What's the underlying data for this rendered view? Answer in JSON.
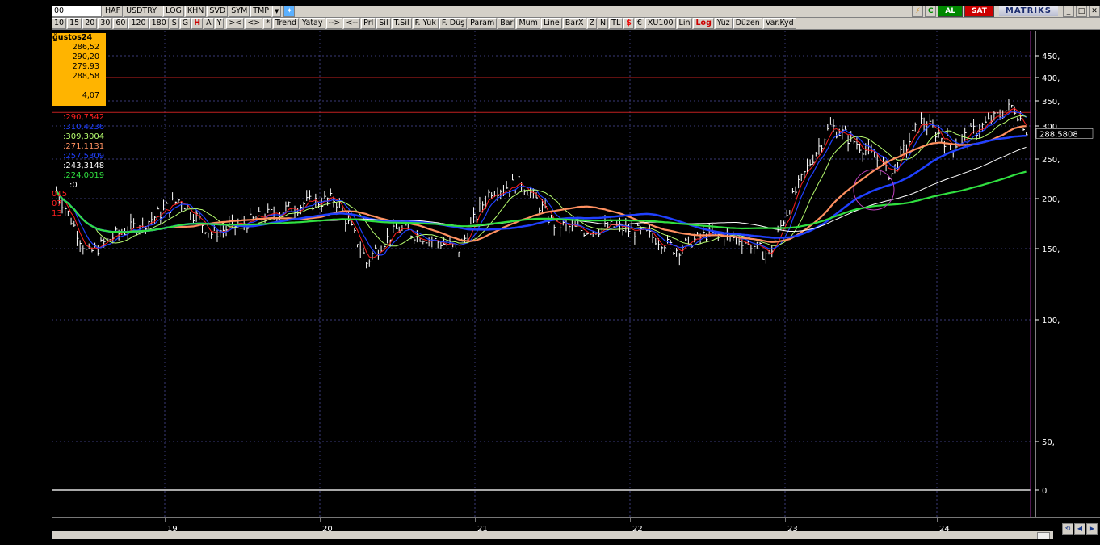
{
  "toolbar1": {
    "symbol_box": "00",
    "buttons": [
      "HAF",
      "USDTRY",
      "LOG",
      "KHN",
      "SVD",
      "SYM",
      "TMP"
    ],
    "dropdown": "▼",
    "al_label": "AL",
    "sat_label": "SAT",
    "logo_text": "MATRIKS",
    "window_buttons": [
      "_",
      "□",
      "✕"
    ],
    "colors": {
      "al": "#008800",
      "sat": "#cc0000"
    }
  },
  "toolbar2": {
    "periods": [
      "10",
      "15",
      "20",
      "30",
      "60",
      "120",
      "180",
      "S",
      "G",
      "H",
      "A",
      "Y"
    ],
    "active_period": "H",
    "tools": [
      ">< ",
      "<>",
      "*",
      "Trend",
      "Yatay",
      "-->",
      "<--",
      "Prl",
      "Sil",
      "T.Sil",
      "F. Yük",
      "F. Düş",
      "Param",
      "Bar",
      "Mum",
      "Line",
      "BarX",
      "Z",
      "N",
      "TL",
      "$",
      "€",
      "XU100",
      "Lin",
      "Log",
      "Yüz",
      "Düzen",
      "Var.Kyd"
    ]
  },
  "infobox": {
    "title": "ğustos24",
    "values": [
      "286,52",
      "290,20",
      "279,93",
      "288,58",
      "",
      "4,07"
    ]
  },
  "indicators": [
    {
      "label": ":290,7542",
      "color": "#ff2020"
    },
    {
      "label": ":310,4236",
      "color": "#2040ff"
    },
    {
      "label": ":309,3004",
      "color": "#b8ff70"
    },
    {
      "label": ":271,1131",
      "color": "#ff9060"
    },
    {
      "label": ":257,5309",
      "color": "#2040ff"
    },
    {
      "label": ":243,3148",
      "color": "#ffffff"
    },
    {
      "label": ":224,0019",
      "color": "#30e040"
    },
    {
      "label": ":0",
      "color": "#ffffff"
    }
  ],
  "side_labels": [
    {
      "label": "015",
      "color": "#ff2020"
    },
    {
      "label": "07",
      "color": "#ff2020"
    },
    {
      "label": "13",
      "color": "#ff2020"
    }
  ],
  "y_axis": {
    "ticks": [
      {
        "value": 450,
        "label": "450,"
      },
      {
        "value": 400,
        "label": "400,"
      },
      {
        "value": 350,
        "label": "350,"
      },
      {
        "value": 300,
        "label": "300,"
      },
      {
        "value": 250,
        "label": "250,"
      },
      {
        "value": 200,
        "label": "200,"
      },
      {
        "value": 150,
        "label": "150,"
      },
      {
        "value": 100,
        "label": "100,"
      },
      {
        "value": 50,
        "label": "50,"
      },
      {
        "value": 0,
        "label": "0"
      }
    ],
    "last_price": "288,5808"
  },
  "x_axis": {
    "labels": [
      "19",
      "20",
      "21",
      "22",
      "23",
      "24"
    ]
  },
  "horizontal_levels": [
    400,
    327
  ],
  "chart_data": {
    "type": "line",
    "x": [
      "2018.3",
      "2018.5",
      "2018.7",
      "2018.9",
      "2019.1",
      "2019.3",
      "2019.5",
      "2019.7",
      "2019.9",
      "2020.1",
      "2020.3",
      "2020.5",
      "2020.7",
      "2020.9",
      "2021.1",
      "2021.3",
      "2021.5",
      "2021.7",
      "2021.9",
      "2022.1",
      "2022.3",
      "2022.5",
      "2022.7",
      "2022.9",
      "2023.1",
      "2023.3",
      "2023.5",
      "2023.7",
      "2023.9",
      "2024.1",
      "2024.3",
      "2024.5",
      "2024.6"
    ],
    "series": [
      {
        "values": [
          210,
          145,
          165,
          178,
          200,
          165,
          175,
          185,
          195,
          200,
          140,
          170,
          160,
          150,
          210,
          220,
          175,
          168,
          172,
          165,
          150,
          165,
          160,
          145,
          220,
          300,
          270,
          230,
          310,
          270,
          300,
          340,
          288
        ]
      }
    ],
    "price_range": [
      130,
      345
    ],
    "moving_average_ends": [
      290.7542,
      310.4236,
      309.3004,
      271.1131,
      257.5309,
      243.3148,
      224.0019
    ],
    "y_scale": "log",
    "grid": true
  }
}
